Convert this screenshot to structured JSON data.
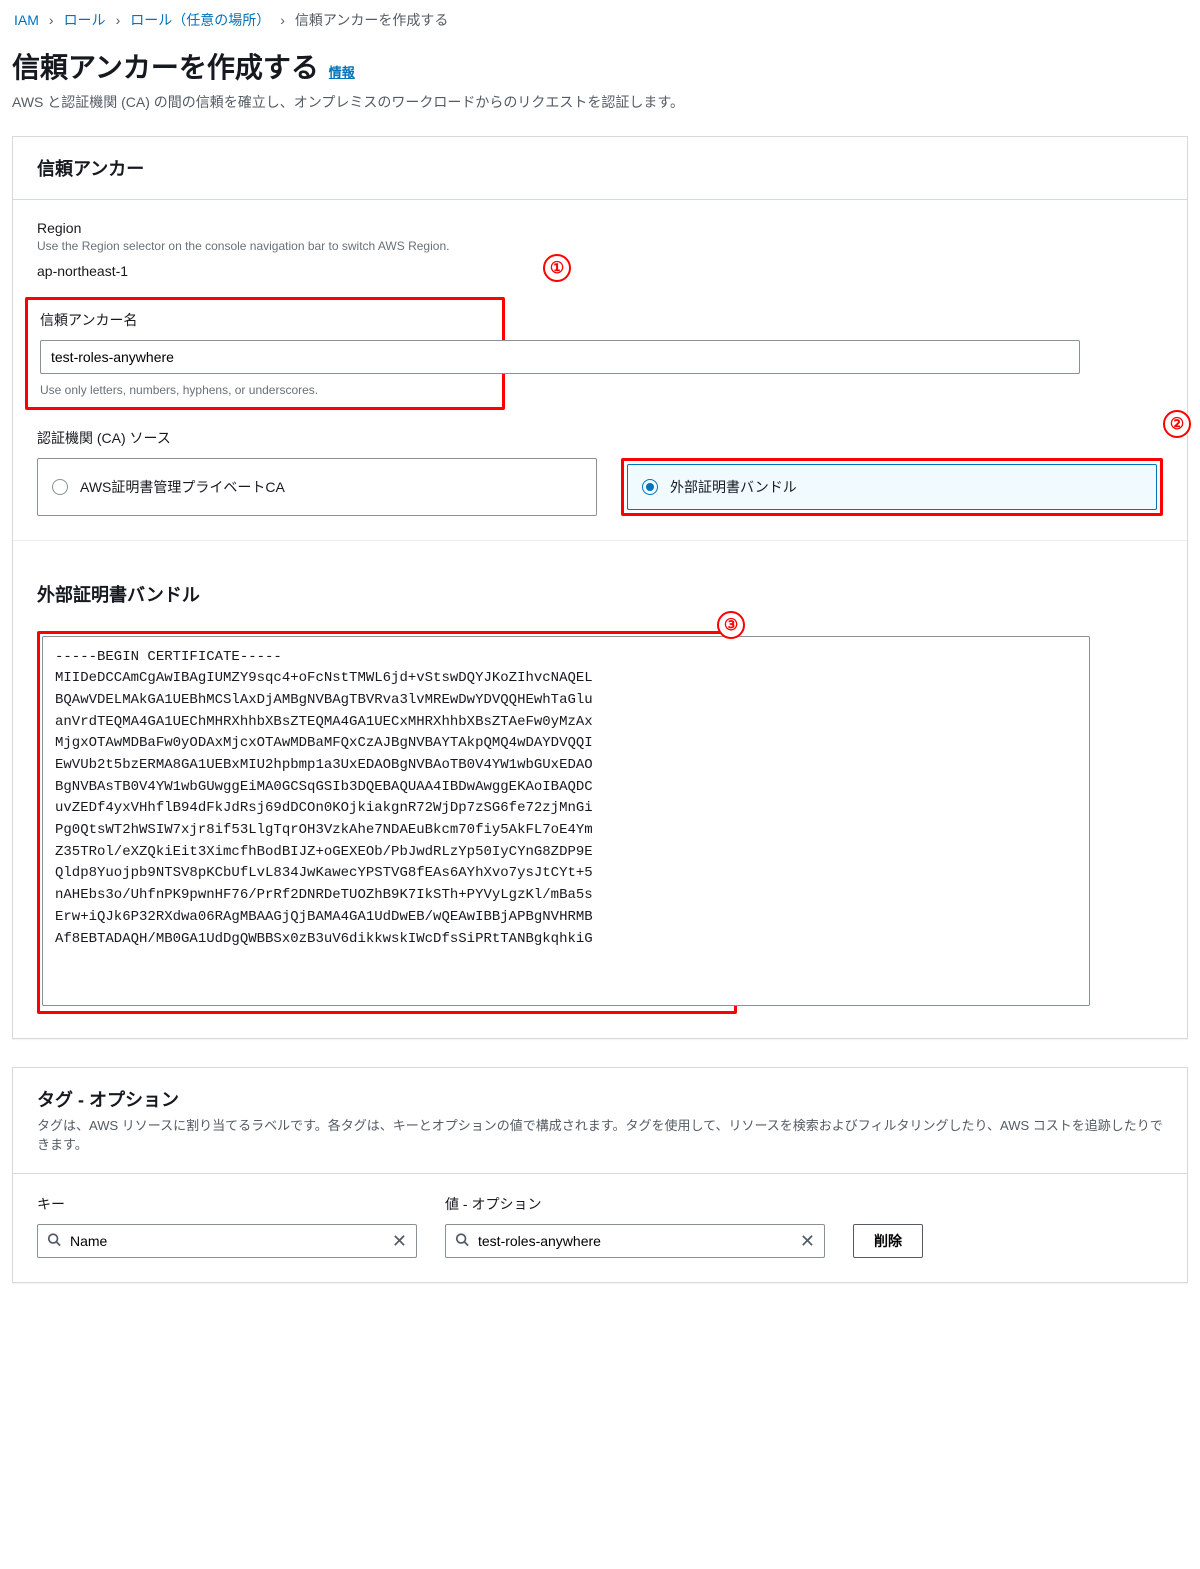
{
  "breadcrumb": {
    "items": [
      "IAM",
      "ロール",
      "ロール（任意の場所）"
    ],
    "current": "信頼アンカーを作成する"
  },
  "page": {
    "title": "信頼アンカーを作成する",
    "info": "情報",
    "desc": "AWS と認証機関 (CA) の間の信頼を確立し、オンプレミスのワークロードからのリクエストを認証します。"
  },
  "trust_anchor": {
    "panel_title": "信頼アンカー",
    "region_label": "Region",
    "region_hint": "Use the Region selector on the console navigation bar to switch AWS Region.",
    "region_value": "ap-northeast-1",
    "name_label": "信頼アンカー名",
    "name_value": "test-roles-anywhere",
    "name_hint": "Use only letters, numbers, hyphens, or underscores.",
    "ca_source_label": "認証機関 (CA) ソース",
    "ca_options": {
      "acm_pca": "AWS証明書管理プライベートCA",
      "external": "外部証明書バンドル"
    },
    "external_bundle_title": "外部証明書バンドル",
    "certificate": "-----BEGIN CERTIFICATE-----\nMIIDeDCCAmCgAwIBAgIUMZY9sqc4+oFcNstTMWL6jd+vStswDQYJKoZIhvcNAQEL\nBQAwVDELMAkGA1UEBhMCSlAxDjAMBgNVBAgTBVRva3lvMREwDwYDVQQHEwhTaGlu\nanVrdTEQMA4GA1UEChMHRXhhbXBsZTEQMA4GA1UECxMHRXhhbXBsZTAeFw0yMzAx\nMjgxOTAwMDBaFw0yODAxMjcxOTAwMDBaMFQxCzAJBgNVBAYTAkpQMQ4wDAYDVQQI\nEwVUb2t5bzERMA8GA1UEBxMIU2hpbmp1a3UxEDAOBgNVBAoTB0V4YW1wbGUxEDAO\nBgNVBAsTB0V4YW1wbGUwggEiMA0GCSqGSIb3DQEBAQUAA4IBDwAwggEKAoIBAQDC\nuvZEDf4yxVHhflB94dFkJdRsj69dDCOn0KOjkiakgnR72WjDp7zSG6fe72zjMnGi\nPg0QtsWT2hWSIW7xjr8if53LlgTqrOH3VzkAhe7NDAEuBkcm70fiy5AkFL7oE4Ym\nZ35TRol/eXZQkiEit3XimcfhBodBIJZ+oGEXEOb/PbJwdRLzYp50IyCYnG8ZDP9E\nQldp8Yuojpb9NTSV8pKCbUfLvL834JwKawecYPSTVG8fEAs6AYhXvo7ysJtCYt+5\nnAHEbs3o/UhfnPK9pwnHF76/PrRf2DNRDeTUOZhB9K7IkSTh+PYVyLgzKl/mBa5s\nErw+iQJk6P32RXdwa06RAgMBAAGjQjBAMA4GA1UdDwEB/wQEAwIBBjAPBgNVHRMB\nAf8EBTADAQH/MB0GA1UdDgQWBBSx0zB3uV6dikkwskIWcDfsSiPRtTANBgkqhkiG"
  },
  "tags": {
    "panel_title": "タグ - オプション",
    "panel_desc": "タグは、AWS リソースに割り当てるラベルです。各タグは、キーとオプションの値で構成されます。タグを使用して、リソースを検索およびフィルタリングしたり、AWS コストを追跡したりできます。",
    "key_label": "キー",
    "value_label": "値 - オプション",
    "row": {
      "key": "Name",
      "value": "test-roles-anywhere"
    },
    "remove_label": "削除"
  },
  "annotations": {
    "one": "①",
    "two": "②",
    "three": "③"
  }
}
